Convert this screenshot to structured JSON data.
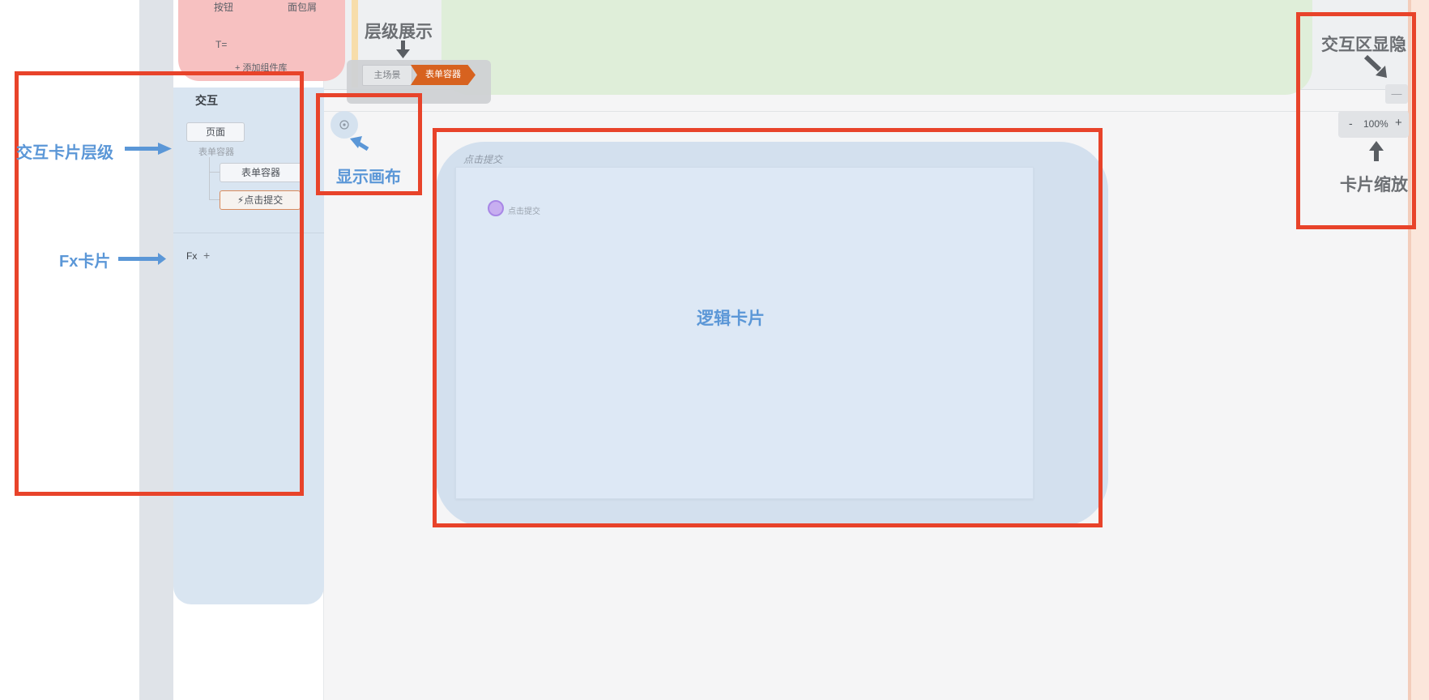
{
  "component_library": {
    "item_button": "按钮",
    "item_breadcrumb": "面包屑",
    "item_text": "T=",
    "add_library": "+ 添加组件库"
  },
  "breadcrumb": {
    "main_scene": "主场景",
    "current": "表单容器"
  },
  "interaction_panel": {
    "title": "交互",
    "tree": {
      "page": "页面",
      "form_container_label": "表单容器",
      "form_container": "表单容器",
      "click_submit": "⚡点击提交"
    },
    "fx_label": "Fx",
    "fx_add": "+"
  },
  "logic_card": {
    "title": "点击提交",
    "node_label": "点击提交",
    "center_label": "逻辑卡片"
  },
  "zoom": {
    "minus": "-",
    "value": "100%",
    "plus": "+",
    "toggle_icon": "—"
  },
  "annotations": {
    "hierarchy_show": "层级展示",
    "show_canvas": "显示画布",
    "interaction_card_level": "交互卡片层级",
    "fx_card": "Fx卡片",
    "interaction_zone_toggle": "交互区显隐",
    "card_zoom": "卡片缩放"
  },
  "colors": {
    "annotation_red": "#e8432a",
    "annotation_blue": "#5b97d7",
    "annotation_gray": "#6c6f73",
    "breadcrumb_active": "#d7621f",
    "component_zone": "#f7c1c1",
    "scene_zone": "#dfeed9",
    "interaction_zone": "#d9e5f1",
    "logic_zone": "#d3e0ee",
    "node_purple": "#c7aef0"
  }
}
